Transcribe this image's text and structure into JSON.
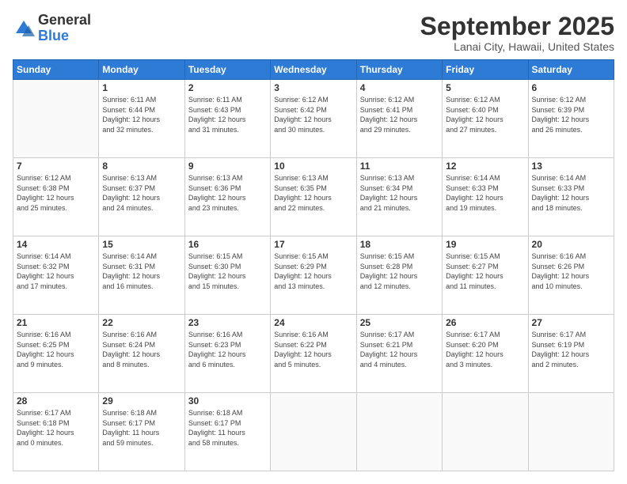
{
  "logo": {
    "general": "General",
    "blue": "Blue"
  },
  "header": {
    "month": "September 2025",
    "location": "Lanai City, Hawaii, United States"
  },
  "weekdays": [
    "Sunday",
    "Monday",
    "Tuesday",
    "Wednesday",
    "Thursday",
    "Friday",
    "Saturday"
  ],
  "weeks": [
    [
      {
        "day": "",
        "info": ""
      },
      {
        "day": "1",
        "info": "Sunrise: 6:11 AM\nSunset: 6:44 PM\nDaylight: 12 hours\nand 32 minutes."
      },
      {
        "day": "2",
        "info": "Sunrise: 6:11 AM\nSunset: 6:43 PM\nDaylight: 12 hours\nand 31 minutes."
      },
      {
        "day": "3",
        "info": "Sunrise: 6:12 AM\nSunset: 6:42 PM\nDaylight: 12 hours\nand 30 minutes."
      },
      {
        "day": "4",
        "info": "Sunrise: 6:12 AM\nSunset: 6:41 PM\nDaylight: 12 hours\nand 29 minutes."
      },
      {
        "day": "5",
        "info": "Sunrise: 6:12 AM\nSunset: 6:40 PM\nDaylight: 12 hours\nand 27 minutes."
      },
      {
        "day": "6",
        "info": "Sunrise: 6:12 AM\nSunset: 6:39 PM\nDaylight: 12 hours\nand 26 minutes."
      }
    ],
    [
      {
        "day": "7",
        "info": "Sunrise: 6:12 AM\nSunset: 6:38 PM\nDaylight: 12 hours\nand 25 minutes."
      },
      {
        "day": "8",
        "info": "Sunrise: 6:13 AM\nSunset: 6:37 PM\nDaylight: 12 hours\nand 24 minutes."
      },
      {
        "day": "9",
        "info": "Sunrise: 6:13 AM\nSunset: 6:36 PM\nDaylight: 12 hours\nand 23 minutes."
      },
      {
        "day": "10",
        "info": "Sunrise: 6:13 AM\nSunset: 6:35 PM\nDaylight: 12 hours\nand 22 minutes."
      },
      {
        "day": "11",
        "info": "Sunrise: 6:13 AM\nSunset: 6:34 PM\nDaylight: 12 hours\nand 21 minutes."
      },
      {
        "day": "12",
        "info": "Sunrise: 6:14 AM\nSunset: 6:33 PM\nDaylight: 12 hours\nand 19 minutes."
      },
      {
        "day": "13",
        "info": "Sunrise: 6:14 AM\nSunset: 6:33 PM\nDaylight: 12 hours\nand 18 minutes."
      }
    ],
    [
      {
        "day": "14",
        "info": "Sunrise: 6:14 AM\nSunset: 6:32 PM\nDaylight: 12 hours\nand 17 minutes."
      },
      {
        "day": "15",
        "info": "Sunrise: 6:14 AM\nSunset: 6:31 PM\nDaylight: 12 hours\nand 16 minutes."
      },
      {
        "day": "16",
        "info": "Sunrise: 6:15 AM\nSunset: 6:30 PM\nDaylight: 12 hours\nand 15 minutes."
      },
      {
        "day": "17",
        "info": "Sunrise: 6:15 AM\nSunset: 6:29 PM\nDaylight: 12 hours\nand 13 minutes."
      },
      {
        "day": "18",
        "info": "Sunrise: 6:15 AM\nSunset: 6:28 PM\nDaylight: 12 hours\nand 12 minutes."
      },
      {
        "day": "19",
        "info": "Sunrise: 6:15 AM\nSunset: 6:27 PM\nDaylight: 12 hours\nand 11 minutes."
      },
      {
        "day": "20",
        "info": "Sunrise: 6:16 AM\nSunset: 6:26 PM\nDaylight: 12 hours\nand 10 minutes."
      }
    ],
    [
      {
        "day": "21",
        "info": "Sunrise: 6:16 AM\nSunset: 6:25 PM\nDaylight: 12 hours\nand 9 minutes."
      },
      {
        "day": "22",
        "info": "Sunrise: 6:16 AM\nSunset: 6:24 PM\nDaylight: 12 hours\nand 8 minutes."
      },
      {
        "day": "23",
        "info": "Sunrise: 6:16 AM\nSunset: 6:23 PM\nDaylight: 12 hours\nand 6 minutes."
      },
      {
        "day": "24",
        "info": "Sunrise: 6:16 AM\nSunset: 6:22 PM\nDaylight: 12 hours\nand 5 minutes."
      },
      {
        "day": "25",
        "info": "Sunrise: 6:17 AM\nSunset: 6:21 PM\nDaylight: 12 hours\nand 4 minutes."
      },
      {
        "day": "26",
        "info": "Sunrise: 6:17 AM\nSunset: 6:20 PM\nDaylight: 12 hours\nand 3 minutes."
      },
      {
        "day": "27",
        "info": "Sunrise: 6:17 AM\nSunset: 6:19 PM\nDaylight: 12 hours\nand 2 minutes."
      }
    ],
    [
      {
        "day": "28",
        "info": "Sunrise: 6:17 AM\nSunset: 6:18 PM\nDaylight: 12 hours\nand 0 minutes."
      },
      {
        "day": "29",
        "info": "Sunrise: 6:18 AM\nSunset: 6:17 PM\nDaylight: 11 hours\nand 59 minutes."
      },
      {
        "day": "30",
        "info": "Sunrise: 6:18 AM\nSunset: 6:17 PM\nDaylight: 11 hours\nand 58 minutes."
      },
      {
        "day": "",
        "info": ""
      },
      {
        "day": "",
        "info": ""
      },
      {
        "day": "",
        "info": ""
      },
      {
        "day": "",
        "info": ""
      }
    ]
  ]
}
